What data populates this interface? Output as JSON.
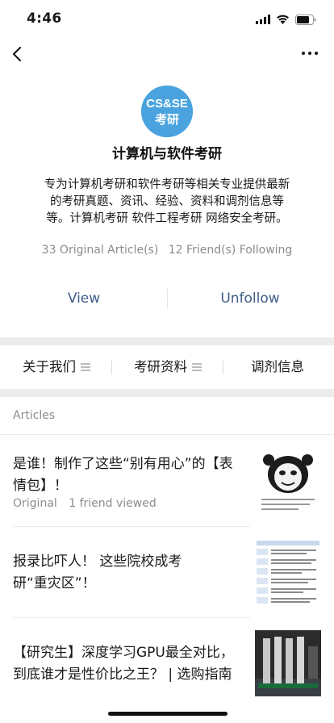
{
  "status_bar": {
    "time": "4:46"
  },
  "account": {
    "avatar_text_top": "CS&SE",
    "avatar_text_bottom": "考研",
    "name": "计算机与软件考研",
    "description_line1": "专为计算机考研和软件考研等相关专业提供最新",
    "description_line2": "的考研真题、资讯、经验、资料和调剂信息等",
    "description_line3": "等。计算机考研 软件工程考研 网络安全考研。",
    "articles_count": "33 Original Article(s)",
    "following": "12 Friend(s) Following"
  },
  "actions": {
    "view": "View",
    "unfollow": "Unfollow"
  },
  "menu": [
    {
      "label": "关于我们",
      "has_submenu": true
    },
    {
      "label": "考研资料",
      "has_submenu": true
    },
    {
      "label": "调剂信息",
      "has_submenu": false
    }
  ],
  "articles_section": {
    "title": "Articles",
    "items": [
      {
        "title_line1": "是谁！制作了这些“别有用心”的【表",
        "title_line2": "情包】！",
        "original": "Original",
        "viewed": "1 friend viewed",
        "thumb": "panda-meme-icon"
      },
      {
        "title_line1": "报录比吓人！ 这些院校成考",
        "title_line2": "研“重灾区”！",
        "thumb": "table-document-icon"
      },
      {
        "title_line1": "【研究生】深度学习GPU最全对比，",
        "title_line2": "到底谁才是性价比之王？ | 选购指南",
        "thumb": "gpu-cards-icon"
      }
    ]
  },
  "colors": {
    "link": "#3e5c8a",
    "avatar_bg": "#4aa3df",
    "meta": "#8c8c8c"
  }
}
